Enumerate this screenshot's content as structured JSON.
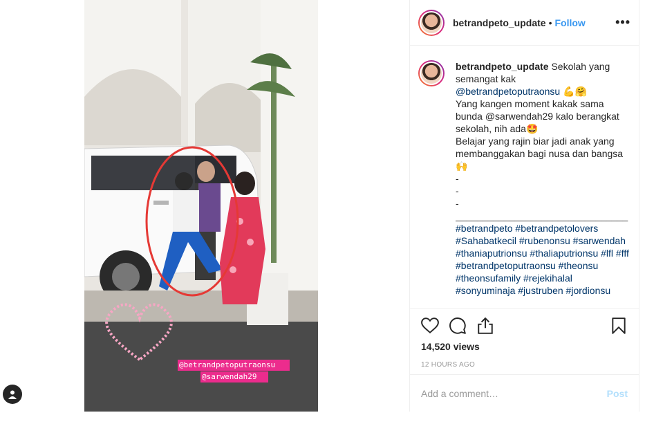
{
  "header": {
    "username": "betrandpeto_update",
    "separator": "•",
    "follow_label": "Follow",
    "more_label": "•••"
  },
  "caption": {
    "username": "betrandpeto_update",
    "lines": [
      "Sekolah yang semangat kak",
      "@betrandpetoputraonsu 💪🤗",
      "Yang kangen moment kakak sama bunda @sarwendah29 kalo berangkat sekolah, nih ada🤩",
      "Belajar yang rajin biar jadi anak yang membanggakan bagi nusa dan bangsa🙌",
      "-",
      "-",
      "-",
      "________________________________"
    ],
    "hashtags": "#betrandpeto #betrandpetolovers #Sahabatkecil #rubenonsu #sarwendah #thaniaputrionsu #thaliaputrionsu #lfl #fff #betrandpetoputraonsu #theonsu #theonsufamily #rejekihalal #sonyuminaja #justruben #jordionsu"
  },
  "video": {
    "overlay_tag_1": "@betrandpetoputraonsu",
    "overlay_tag_2": "@sarwendah29"
  },
  "stats": {
    "views": "14,520 views",
    "time": "12 HOURS AGO"
  },
  "comment_box": {
    "placeholder": "Add a comment…",
    "post_label": "Post"
  },
  "colors": {
    "link": "#003569",
    "follow": "#3897f0",
    "post_disabled": "#b2dffc",
    "annotation_circle": "#e53935"
  },
  "icons": [
    "heart-icon",
    "comment-icon",
    "share-icon",
    "bookmark-icon",
    "more-icon",
    "profile-icon"
  ]
}
